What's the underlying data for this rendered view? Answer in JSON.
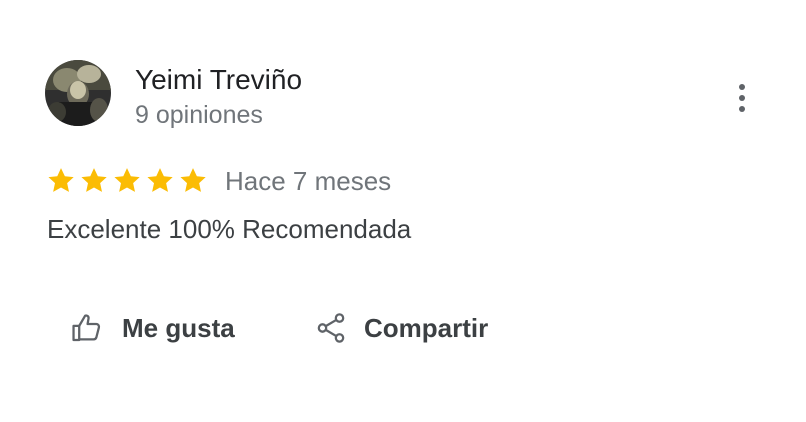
{
  "review": {
    "author": {
      "name": "Yeimi Treviño",
      "meta": "9 opiniones"
    },
    "rating": 5,
    "date": "Hace 7 meses",
    "text": "Excelente 100% Recomendada"
  },
  "actions": {
    "like_label": "Me gusta",
    "share_label": "Compartir"
  },
  "icons": {
    "star": "star-icon",
    "like": "thumb-up-icon",
    "share": "share-icon",
    "more": "more-vert-icon"
  },
  "colors": {
    "star": "#fbbc04",
    "text_primary": "#202124",
    "text_secondary": "#70757a",
    "icon": "#5f6368"
  }
}
